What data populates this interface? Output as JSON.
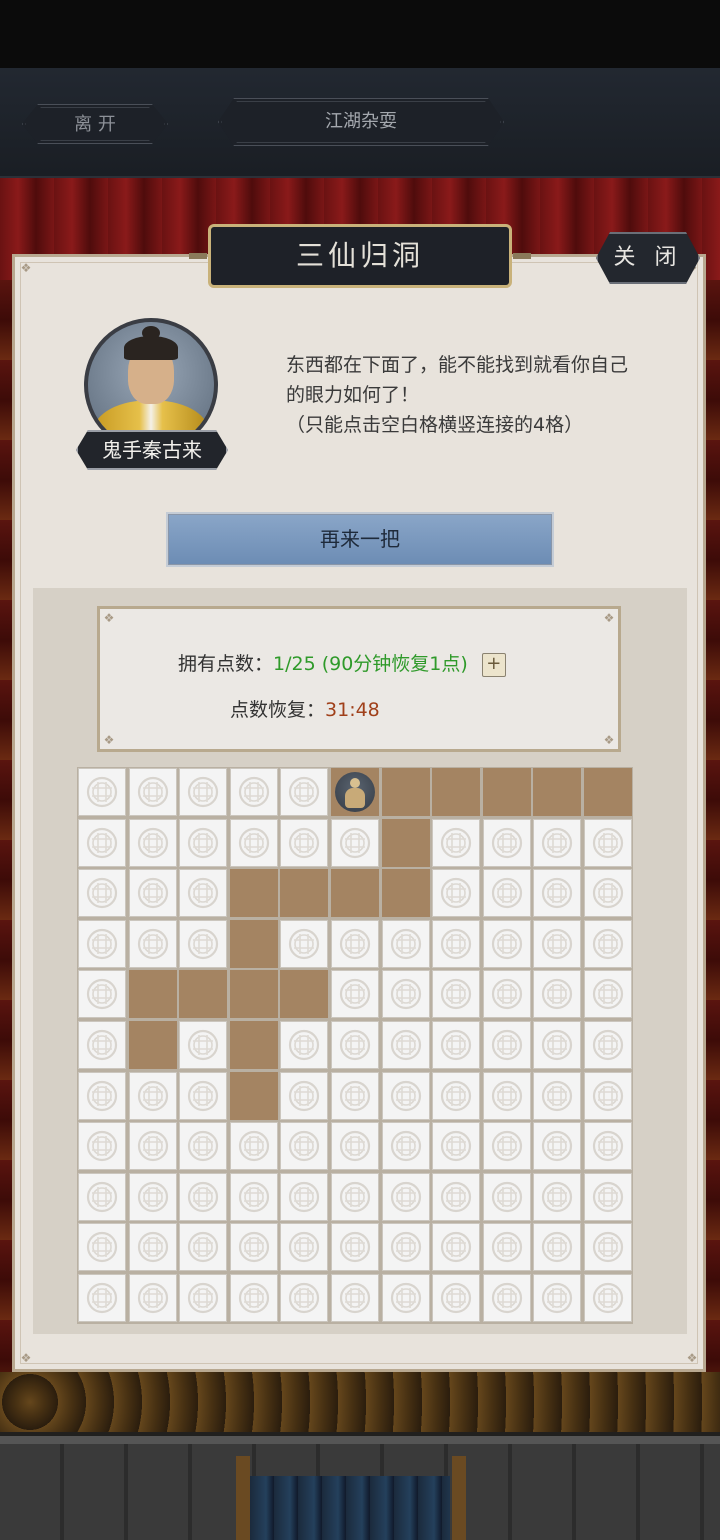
{
  "header": {
    "leave_label": "离 开",
    "game_title": "江湖杂耍"
  },
  "dialog": {
    "title": "三仙归洞",
    "close_label": "关 闭",
    "npc_name": "鬼手秦古来",
    "npc_icon": "portrait-npc",
    "description_line1": "东西都在下面了，能不能找到就看你自己",
    "description_line2": "的眼力如何了！",
    "description_line3": "（只能点击空白格横竖连接的4格）",
    "replay_label": "再来一把"
  },
  "points": {
    "owned_label": "拥有点数：",
    "owned_value": "1/25 (90分钟恢复1点)",
    "recover_label": "点数恢复：",
    "recover_timer": "31:48",
    "add_icon": "plus-icon",
    "green": "#2f9a2a",
    "red": "#a0401a"
  },
  "board": {
    "rows": 11,
    "cols": 11,
    "tile_icon": "lattice-coin-icon",
    "empty_color": "#a48462",
    "grid": [
      "TTTTTFEEEEE",
      "TTTTTTETTTT",
      "TTTEEEETTTT",
      "TTTETTTTTTT",
      "TEEEETTTTTT",
      "TETETTTTTTT",
      "TTTETTTTTTT",
      "TTTTTTTTTTT",
      "TTTTTTTTTTT",
      "TTTTTTTTTTT",
      "TTTTTTTTTTT"
    ]
  }
}
